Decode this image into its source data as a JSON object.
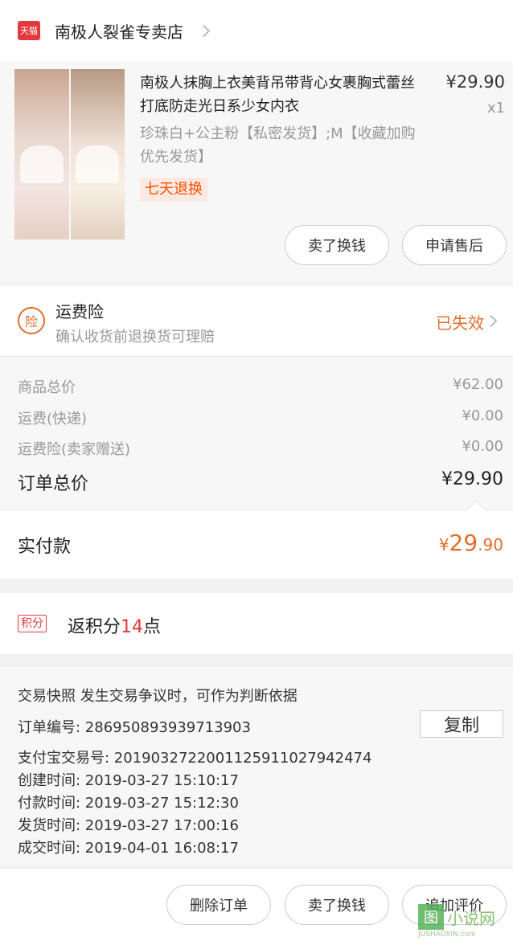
{
  "shop": {
    "badge": "天猫",
    "name": "南极人裂雀专卖店"
  },
  "product": {
    "title": "南极人抹胸上衣美背吊带背心女裹胸式蕾丝打底防走光日系少女内衣",
    "price": "¥29.90",
    "quantity": "x1",
    "sku": "珍珠白+公主粉【私密发货】;M【收藏加购优先发货】",
    "tag": "七天退换",
    "buttons": {
      "sell": "卖了换钱",
      "after_sale": "申请售后"
    }
  },
  "insurance": {
    "icon": "险",
    "title": "运费险",
    "subtitle": "确认收货前退换货可理赔",
    "status": "已失效"
  },
  "costs": [
    {
      "label": "商品总价",
      "value": "¥62.00"
    },
    {
      "label": "运费(快递)",
      "value": "¥0.00"
    },
    {
      "label": "运费险(卖家赠送)",
      "value": "¥0.00"
    }
  ],
  "order_total": {
    "label": "订单总价",
    "value": "¥29.90"
  },
  "paid": {
    "label": "实付款",
    "currency": "¥",
    "integer": "29",
    "decimal": ".90"
  },
  "points": {
    "badge": "积分",
    "prefix": "返积分",
    "number": "14",
    "suffix": "点"
  },
  "order_info": {
    "snapshot": "交易快照   发生交易争议时，可作为判断依据",
    "order_no": "订单编号:   286950893939713903",
    "copy_label": "复制",
    "alipay_no": "支付宝交易号:   2019032722001125911027942474",
    "created": "创建时间:   2019-03-27 15:10:17",
    "paid": "付款时间:   2019-03-27 15:12:30",
    "shipped": "发货时间:   2019-03-27 17:00:16",
    "completed": "成交时间:   2019-04-01 16:08:17"
  },
  "footer": {
    "delete": "删除订单",
    "sell": "卖了换钱",
    "review": "追加评价"
  },
  "watermark": {
    "icon": "图",
    "text": "小说网",
    "url": "JUSHAOXIN.com"
  }
}
